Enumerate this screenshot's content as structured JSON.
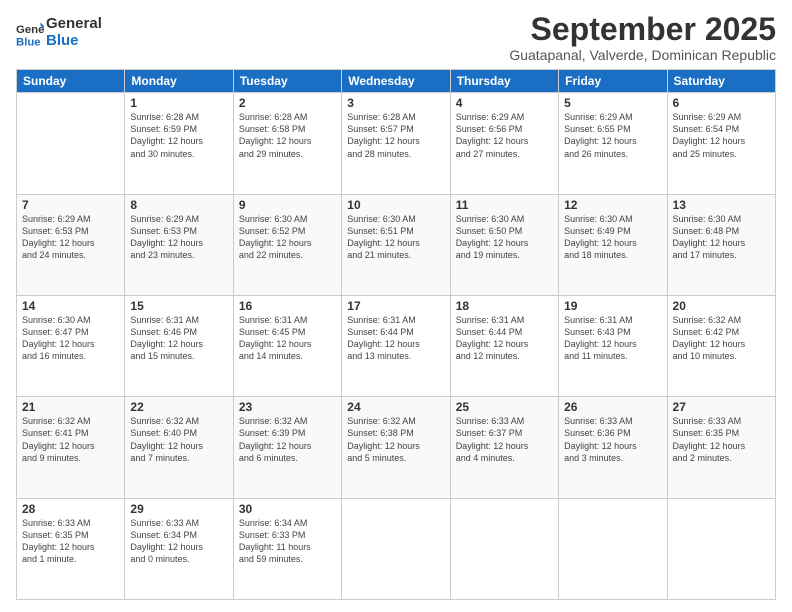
{
  "header": {
    "logo_line1": "General",
    "logo_line2": "Blue",
    "month": "September 2025",
    "location": "Guatapanal, Valverde, Dominican Republic"
  },
  "days_of_week": [
    "Sunday",
    "Monday",
    "Tuesday",
    "Wednesday",
    "Thursday",
    "Friday",
    "Saturday"
  ],
  "weeks": [
    [
      {
        "day": "",
        "info": ""
      },
      {
        "day": "1",
        "info": "Sunrise: 6:28 AM\nSunset: 6:59 PM\nDaylight: 12 hours\nand 30 minutes."
      },
      {
        "day": "2",
        "info": "Sunrise: 6:28 AM\nSunset: 6:58 PM\nDaylight: 12 hours\nand 29 minutes."
      },
      {
        "day": "3",
        "info": "Sunrise: 6:28 AM\nSunset: 6:57 PM\nDaylight: 12 hours\nand 28 minutes."
      },
      {
        "day": "4",
        "info": "Sunrise: 6:29 AM\nSunset: 6:56 PM\nDaylight: 12 hours\nand 27 minutes."
      },
      {
        "day": "5",
        "info": "Sunrise: 6:29 AM\nSunset: 6:55 PM\nDaylight: 12 hours\nand 26 minutes."
      },
      {
        "day": "6",
        "info": "Sunrise: 6:29 AM\nSunset: 6:54 PM\nDaylight: 12 hours\nand 25 minutes."
      }
    ],
    [
      {
        "day": "7",
        "info": "Sunrise: 6:29 AM\nSunset: 6:53 PM\nDaylight: 12 hours\nand 24 minutes."
      },
      {
        "day": "8",
        "info": "Sunrise: 6:29 AM\nSunset: 6:53 PM\nDaylight: 12 hours\nand 23 minutes."
      },
      {
        "day": "9",
        "info": "Sunrise: 6:30 AM\nSunset: 6:52 PM\nDaylight: 12 hours\nand 22 minutes."
      },
      {
        "day": "10",
        "info": "Sunrise: 6:30 AM\nSunset: 6:51 PM\nDaylight: 12 hours\nand 21 minutes."
      },
      {
        "day": "11",
        "info": "Sunrise: 6:30 AM\nSunset: 6:50 PM\nDaylight: 12 hours\nand 19 minutes."
      },
      {
        "day": "12",
        "info": "Sunrise: 6:30 AM\nSunset: 6:49 PM\nDaylight: 12 hours\nand 18 minutes."
      },
      {
        "day": "13",
        "info": "Sunrise: 6:30 AM\nSunset: 6:48 PM\nDaylight: 12 hours\nand 17 minutes."
      }
    ],
    [
      {
        "day": "14",
        "info": "Sunrise: 6:30 AM\nSunset: 6:47 PM\nDaylight: 12 hours\nand 16 minutes."
      },
      {
        "day": "15",
        "info": "Sunrise: 6:31 AM\nSunset: 6:46 PM\nDaylight: 12 hours\nand 15 minutes."
      },
      {
        "day": "16",
        "info": "Sunrise: 6:31 AM\nSunset: 6:45 PM\nDaylight: 12 hours\nand 14 minutes."
      },
      {
        "day": "17",
        "info": "Sunrise: 6:31 AM\nSunset: 6:44 PM\nDaylight: 12 hours\nand 13 minutes."
      },
      {
        "day": "18",
        "info": "Sunrise: 6:31 AM\nSunset: 6:44 PM\nDaylight: 12 hours\nand 12 minutes."
      },
      {
        "day": "19",
        "info": "Sunrise: 6:31 AM\nSunset: 6:43 PM\nDaylight: 12 hours\nand 11 minutes."
      },
      {
        "day": "20",
        "info": "Sunrise: 6:32 AM\nSunset: 6:42 PM\nDaylight: 12 hours\nand 10 minutes."
      }
    ],
    [
      {
        "day": "21",
        "info": "Sunrise: 6:32 AM\nSunset: 6:41 PM\nDaylight: 12 hours\nand 9 minutes."
      },
      {
        "day": "22",
        "info": "Sunrise: 6:32 AM\nSunset: 6:40 PM\nDaylight: 12 hours\nand 7 minutes."
      },
      {
        "day": "23",
        "info": "Sunrise: 6:32 AM\nSunset: 6:39 PM\nDaylight: 12 hours\nand 6 minutes."
      },
      {
        "day": "24",
        "info": "Sunrise: 6:32 AM\nSunset: 6:38 PM\nDaylight: 12 hours\nand 5 minutes."
      },
      {
        "day": "25",
        "info": "Sunrise: 6:33 AM\nSunset: 6:37 PM\nDaylight: 12 hours\nand 4 minutes."
      },
      {
        "day": "26",
        "info": "Sunrise: 6:33 AM\nSunset: 6:36 PM\nDaylight: 12 hours\nand 3 minutes."
      },
      {
        "day": "27",
        "info": "Sunrise: 6:33 AM\nSunset: 6:35 PM\nDaylight: 12 hours\nand 2 minutes."
      }
    ],
    [
      {
        "day": "28",
        "info": "Sunrise: 6:33 AM\nSunset: 6:35 PM\nDaylight: 12 hours\nand 1 minute."
      },
      {
        "day": "29",
        "info": "Sunrise: 6:33 AM\nSunset: 6:34 PM\nDaylight: 12 hours\nand 0 minutes."
      },
      {
        "day": "30",
        "info": "Sunrise: 6:34 AM\nSunset: 6:33 PM\nDaylight: 11 hours\nand 59 minutes."
      },
      {
        "day": "",
        "info": ""
      },
      {
        "day": "",
        "info": ""
      },
      {
        "day": "",
        "info": ""
      },
      {
        "day": "",
        "info": ""
      }
    ]
  ]
}
